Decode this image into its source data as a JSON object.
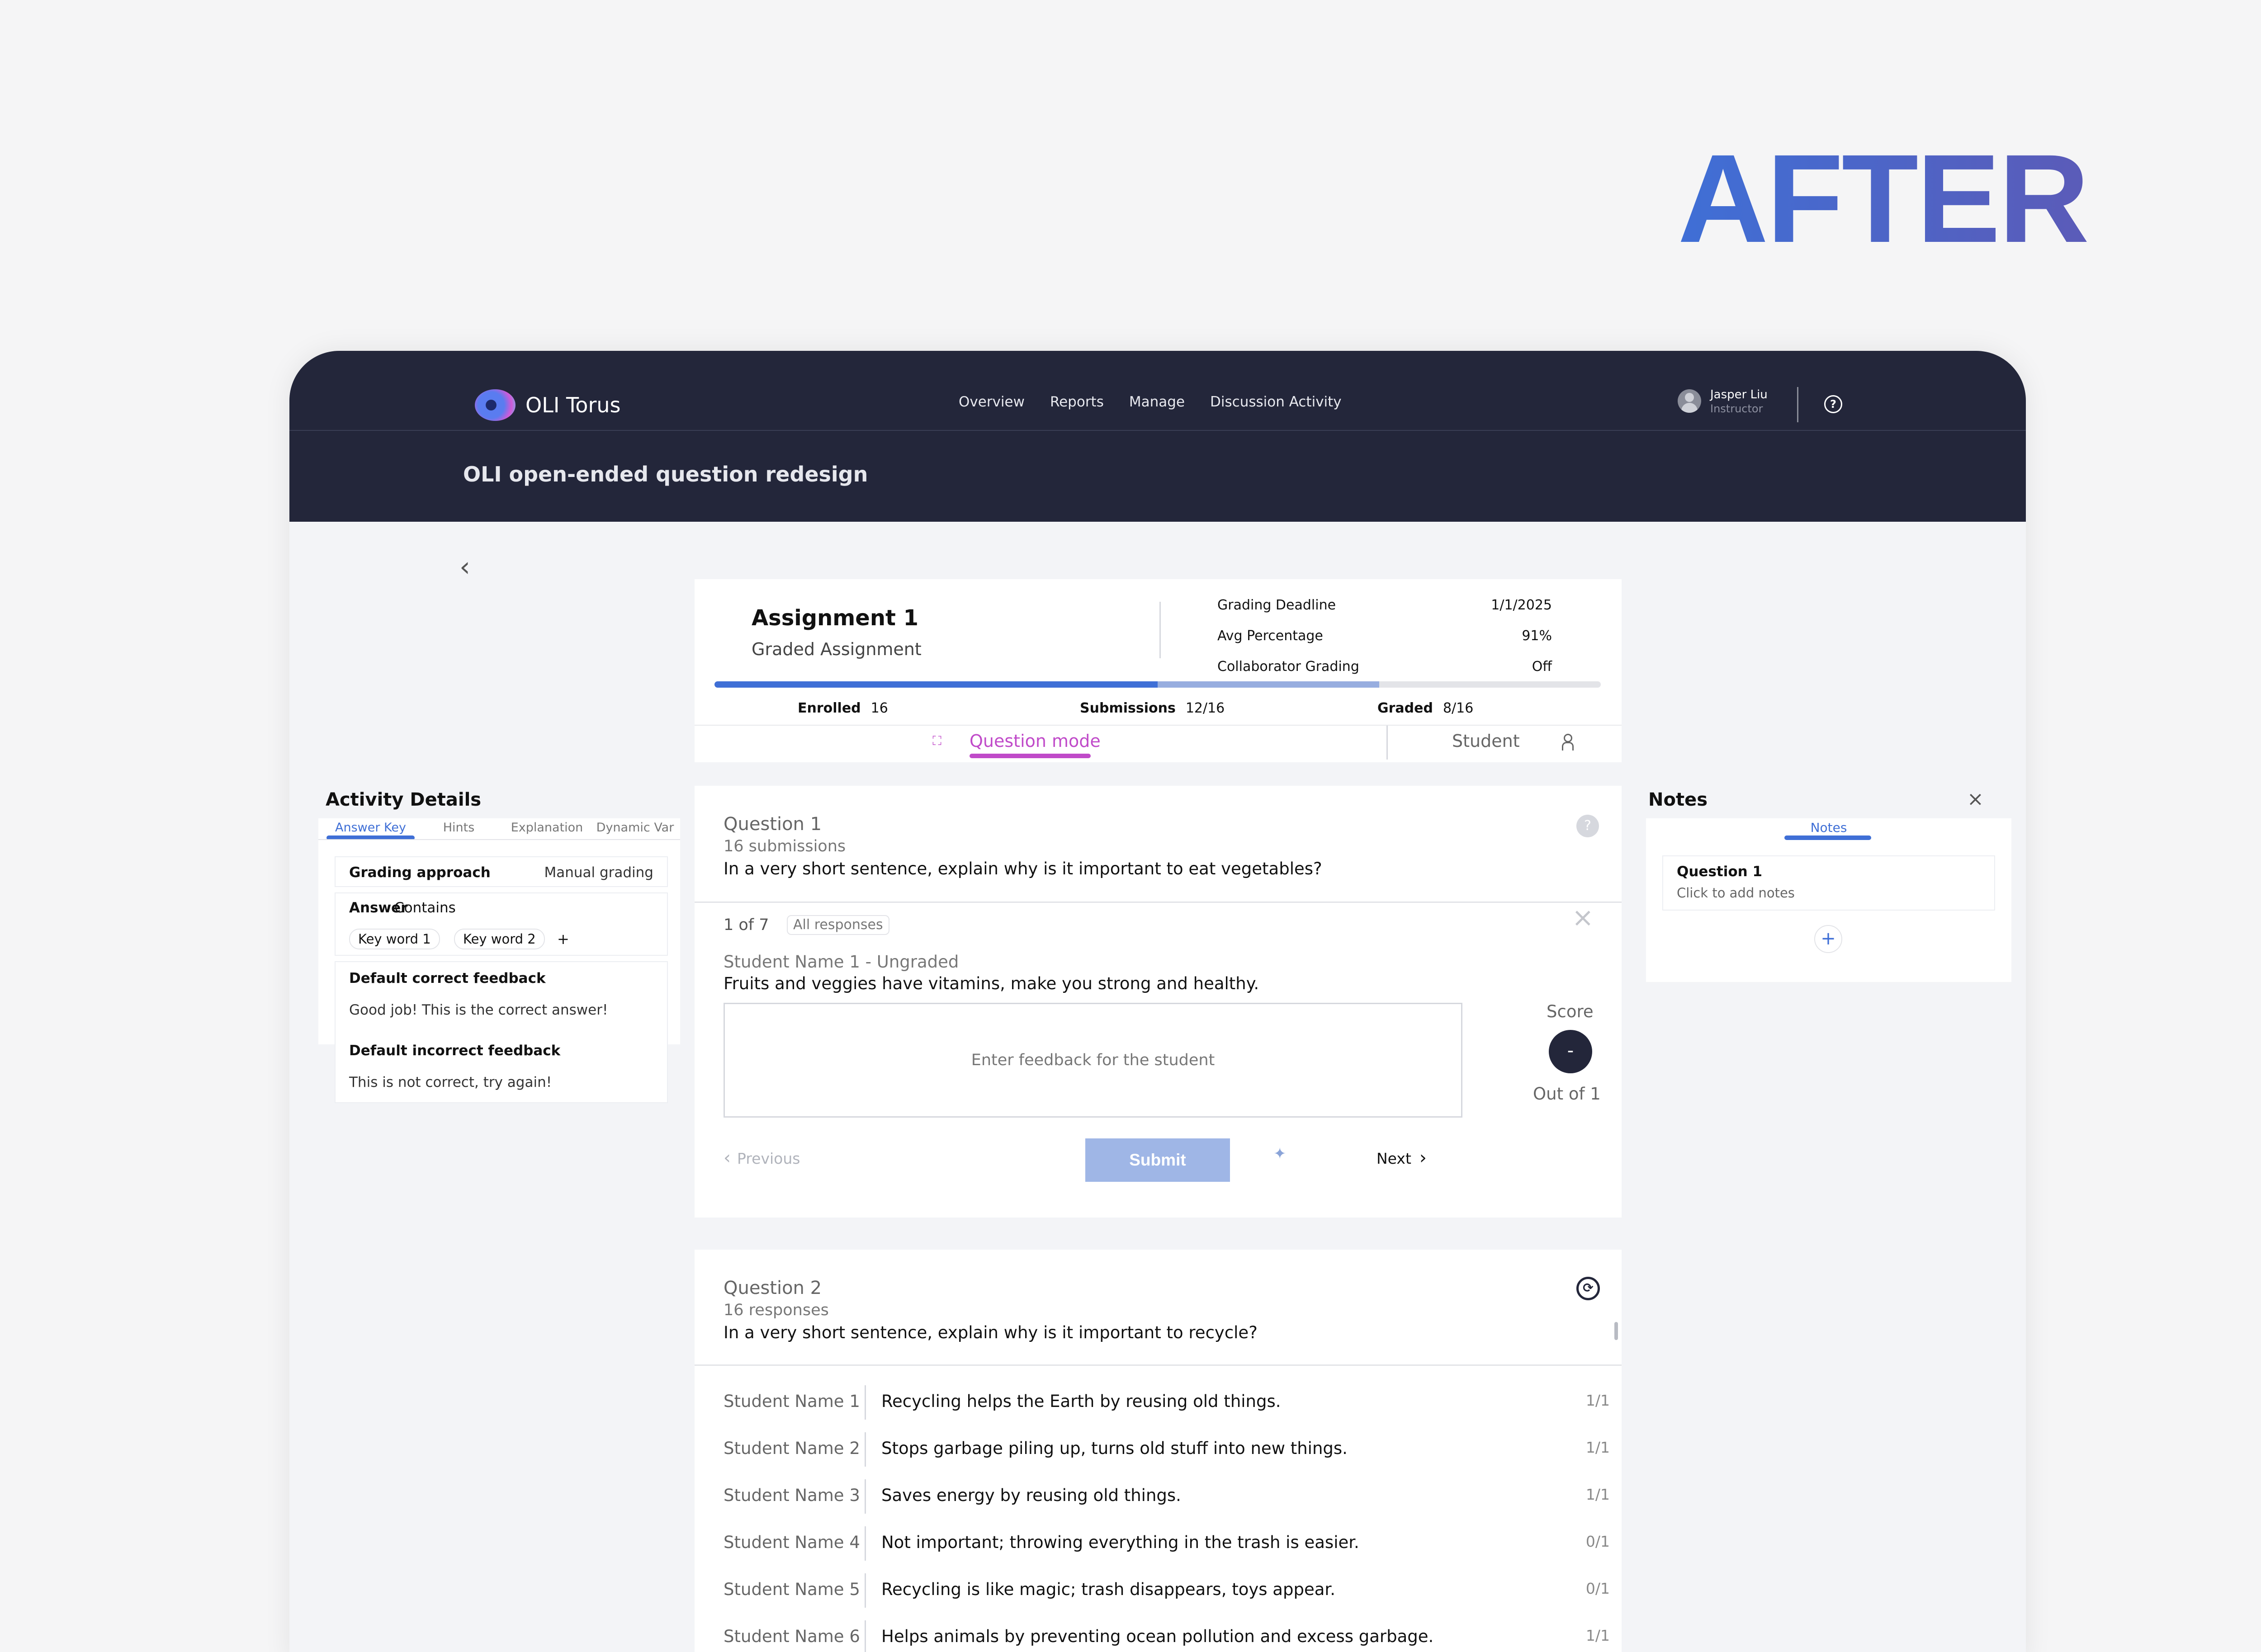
{
  "hero_label": "AFTER",
  "app": {
    "logo_text": "OLI Torus",
    "nav": [
      "Overview",
      "Reports",
      "Manage",
      "Discussion Activity"
    ],
    "user_name": "Jasper Liu",
    "user_role": "Instructor",
    "help_icon": "question-circle-icon",
    "course_title": "OLI open-ended question redesign"
  },
  "assignment": {
    "title": "Assignment 1",
    "subtitle": "Graded Assignment",
    "details": [
      {
        "label": "Grading Deadline",
        "value": "1/1/2025"
      },
      {
        "label": "Avg Percentage",
        "value": "91%"
      },
      {
        "label": "Collaborator Grading",
        "value": "Off"
      }
    ],
    "progress": {
      "graded_fraction": 0.5,
      "submitted_fraction": 0.75
    },
    "stats": [
      {
        "label": "Enrolled",
        "value": "16"
      },
      {
        "label": "Submissions",
        "value": "12/16"
      },
      {
        "label": "Graded",
        "value": "8/16"
      }
    ],
    "modes": {
      "question": "Question mode",
      "student": "Student"
    }
  },
  "activity_details": {
    "title": "Activity Details",
    "tabs": [
      "Answer Key",
      "Hints",
      "Explanation",
      "Dynamic Var"
    ],
    "active_tab": "Answer Key",
    "grading_approach_label": "Grading approach",
    "grading_approach_value": "Manual grading",
    "answer_label": "Answer",
    "answer_mode": "Contains",
    "keywords": [
      "Key word 1",
      "Key word 2"
    ],
    "add_keyword": "+",
    "correct_feedback_label": "Default correct feedback",
    "correct_feedback": "Good job! This is the correct answer!",
    "incorrect_feedback_label": "Default incorrect feedback",
    "incorrect_feedback": "This is not correct, try again!"
  },
  "notes": {
    "title": "Notes",
    "tab": "Notes",
    "items": [
      {
        "title": "Question 1",
        "subtitle": "Click to add notes"
      }
    ],
    "add": "+"
  },
  "question1": {
    "label": "Question 1",
    "count": "16 submissions",
    "text": "In a very short sentence, explain why is it important to eat vegetables?",
    "badge": "?",
    "position": "1 of 7",
    "filter": "All responses",
    "student": "Student Name 1 - Ungraded",
    "response": "Fruits and veggies have vitamins, make you strong and healthy.",
    "feedback_placeholder": "Enter feedback for the student",
    "score_label": "Score",
    "score_value": "-",
    "out_of": "Out of 1",
    "previous": "Previous",
    "submit": "Submit",
    "next": "Next"
  },
  "question2": {
    "label": "Question 2",
    "count": "16 responses",
    "text": "In a very short sentence, explain why is it important to recycle?",
    "responses": [
      {
        "name": "Student Name 1",
        "text": "Recycling helps the Earth by reusing old things.",
        "score": "1/1"
      },
      {
        "name": "Student Name 2",
        "text": "Stops garbage piling up, turns old stuff into new things.",
        "score": "1/1"
      },
      {
        "name": "Student Name 3",
        "text": "Saves energy by reusing old things.",
        "score": "1/1"
      },
      {
        "name": "Student Name 4",
        "text": "Not important; throwing everything in the trash is easier.",
        "score": "0/1"
      },
      {
        "name": "Student Name 5",
        "text": "Recycling is like magic; trash disappears, toys appear.",
        "score": "0/1"
      },
      {
        "name": "Student Name 6",
        "text": "Helps animals by preventing ocean pollution and excess garbage.",
        "score": "1/1"
      }
    ]
  },
  "colors": {
    "accent_blue": "#3f6fd6",
    "accent_magenta": "#c04ac9",
    "header_dark": "#23263a"
  }
}
